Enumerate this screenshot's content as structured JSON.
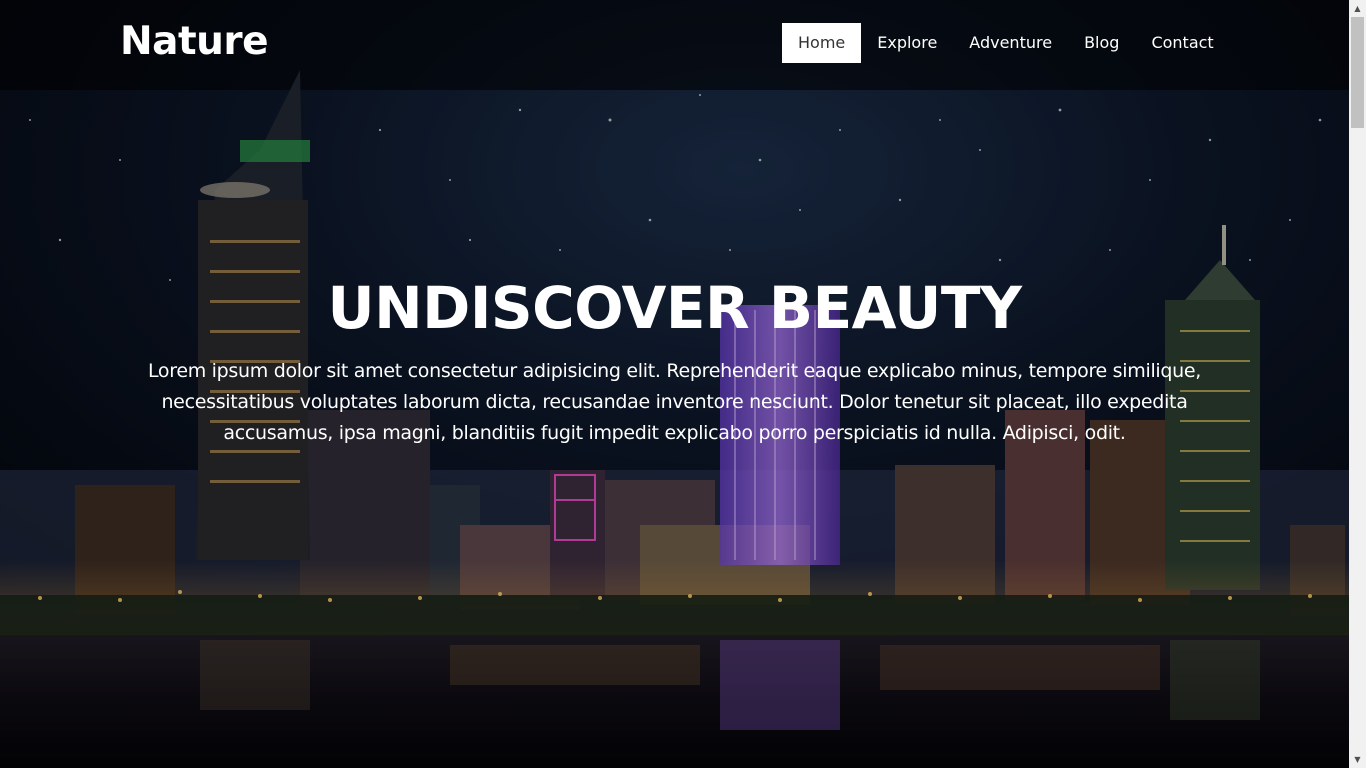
{
  "header": {
    "logo": "Nature",
    "nav": [
      {
        "label": "Home",
        "active": true
      },
      {
        "label": "Explore",
        "active": false
      },
      {
        "label": "Adventure",
        "active": false
      },
      {
        "label": "Blog",
        "active": false
      },
      {
        "label": "Contact",
        "active": false
      }
    ]
  },
  "hero": {
    "title": "UNDISCOVER BEAUTY",
    "text": "Lorem ipsum dolor sit amet consectetur adipisicing elit. Reprehenderit eaque explicabo minus, tempore similique, necessitatibus voluptates laborum dicta, recusandae inventore nesciunt. Dolor tenetur sit placeat, illo expedita accusamus, ipsa magni, blanditiis fugit impedit explicabo porro perspiciatis id nulla. Adipisci, odit.",
    "background": "night-city-skyline-image"
  },
  "scrollbar": {
    "up_icon": "▲",
    "down_icon": "▼"
  },
  "colors": {
    "active_nav_bg": "#ffffff",
    "active_nav_text": "#333333",
    "text": "#ffffff",
    "scrollbar_track": "#f1f1f1",
    "scrollbar_thumb": "#c1c1c1"
  }
}
